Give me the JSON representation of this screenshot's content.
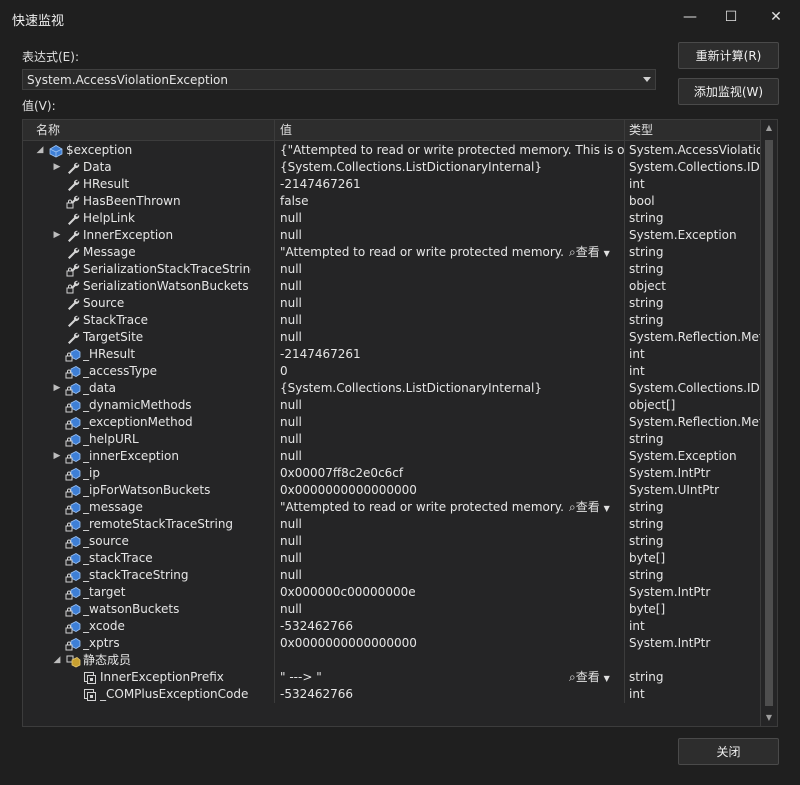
{
  "window": {
    "title": "快速监视",
    "minimize": "—",
    "maximize": "☐",
    "close": "✕"
  },
  "expression": {
    "label": "表达式(E):",
    "value": "System.AccessViolationException"
  },
  "value_label": "值(V):",
  "buttons": {
    "recalc": "重新计算(R)",
    "add_watch": "添加监视(W)",
    "close": "关闭"
  },
  "columns": {
    "name": "名称",
    "value": "值",
    "type": "类型"
  },
  "view_label": "查看",
  "rows": [
    {
      "name": "$exception",
      "value": "{\"Attempted to read or write protected memory. This is often an...",
      "type": "System.AccessViolatio...",
      "icon": "exception-object-icon"
    },
    {
      "name": "Data",
      "value": "{System.Collections.ListDictionaryInternal}",
      "type": "System.Collections.IDi...",
      "icon": "wrench-property-icon"
    },
    {
      "name": "HResult",
      "value": "-2147467261",
      "type": "int",
      "icon": "wrench-property-icon"
    },
    {
      "name": "HasBeenThrown",
      "value": "false",
      "type": "bool",
      "icon": "locked-property-icon"
    },
    {
      "name": "HelpLink",
      "value": "null",
      "type": "string",
      "icon": "wrench-property-icon"
    },
    {
      "name": "InnerException",
      "value": "null",
      "type": "System.Exception",
      "icon": "wrench-property-icon"
    },
    {
      "name": "Message",
      "value": "\"Attempted to read or write protected memory. This ...",
      "type": "string",
      "icon": "wrench-property-icon"
    },
    {
      "name": "SerializationStackTraceString",
      "value": "null",
      "type": "string",
      "icon": "locked-property-icon"
    },
    {
      "name": "SerializationWatsonBuckets",
      "value": "null",
      "type": "object",
      "icon": "locked-property-icon"
    },
    {
      "name": "Source",
      "value": "null",
      "type": "string",
      "icon": "wrench-property-icon"
    },
    {
      "name": "StackTrace",
      "value": "null",
      "type": "string",
      "icon": "wrench-property-icon"
    },
    {
      "name": "TargetSite",
      "value": "null",
      "type": "System.Reflection.Met...",
      "icon": "wrench-property-icon"
    },
    {
      "name": "_HResult",
      "value": "-2147467261",
      "type": "int",
      "icon": "private-field-icon"
    },
    {
      "name": "_accessType",
      "value": "0",
      "type": "int",
      "icon": "private-field-icon"
    },
    {
      "name": "_data",
      "value": "{System.Collections.ListDictionaryInternal}",
      "type": "System.Collections.IDi...",
      "icon": "private-field-icon"
    },
    {
      "name": "_dynamicMethods",
      "value": "null",
      "type": "object[]",
      "icon": "private-field-icon"
    },
    {
      "name": "_exceptionMethod",
      "value": "null",
      "type": "System.Reflection.Met...",
      "icon": "private-field-icon"
    },
    {
      "name": "_helpURL",
      "value": "null",
      "type": "string",
      "icon": "private-field-icon"
    },
    {
      "name": "_innerException",
      "value": "null",
      "type": "System.Exception",
      "icon": "private-field-icon"
    },
    {
      "name": "_ip",
      "value": "0x00007ff8c2e0c6cf",
      "type": "System.IntPtr",
      "icon": "private-field-icon"
    },
    {
      "name": "_ipForWatsonBuckets",
      "value": "0x0000000000000000",
      "type": "System.UIntPtr",
      "icon": "private-field-icon"
    },
    {
      "name": "_message",
      "value": "\"Attempted to read or write protected memory. This ...",
      "type": "string",
      "icon": "private-field-icon"
    },
    {
      "name": "_remoteStackTraceString",
      "value": "null",
      "type": "string",
      "icon": "private-field-icon"
    },
    {
      "name": "_source",
      "value": "null",
      "type": "string",
      "icon": "private-field-icon"
    },
    {
      "name": "_stackTrace",
      "value": "null",
      "type": "byte[]",
      "icon": "private-field-icon"
    },
    {
      "name": "_stackTraceString",
      "value": "null",
      "type": "string",
      "icon": "private-field-icon"
    },
    {
      "name": "_target",
      "value": "0x000000c00000000e",
      "type": "System.IntPtr",
      "icon": "private-field-icon"
    },
    {
      "name": "_watsonBuckets",
      "value": "null",
      "type": "byte[]",
      "icon": "private-field-icon"
    },
    {
      "name": "_xcode",
      "value": "-532462766",
      "type": "int",
      "icon": "private-field-icon"
    },
    {
      "name": "_xptrs",
      "value": "0x0000000000000000",
      "type": "System.IntPtr",
      "icon": "private-field-icon"
    },
    {
      "name": "静态成员",
      "value": "",
      "type": "",
      "icon": "static-members-icon"
    },
    {
      "name": "InnerExceptionPrefix",
      "value": "\" ---> \"",
      "type": "string",
      "icon": "static-field-icon"
    },
    {
      "name": "_COMPlusExceptionCode",
      "value": "-532462766",
      "type": "int",
      "icon": "static-field-icon"
    }
  ]
}
